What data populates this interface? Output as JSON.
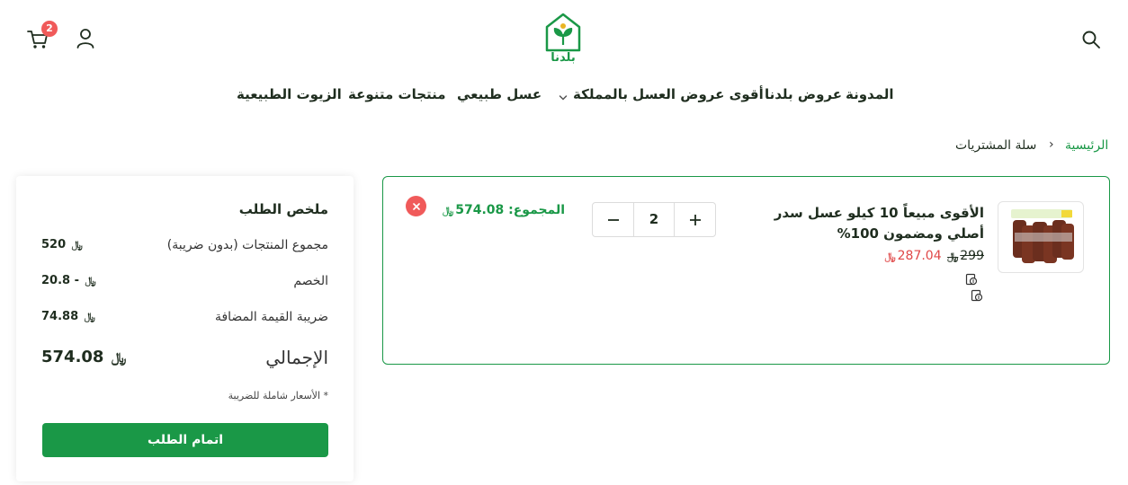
{
  "header": {
    "cart_count": "2",
    "logo_text": "بلدنا",
    "icons": [
      "cart-icon",
      "user-icon",
      "logo",
      "search-icon"
    ]
  },
  "nav": {
    "items": [
      {
        "label": "المدونة"
      },
      {
        "label": "عروض بلدنا"
      },
      {
        "label": "أقوى عروض العسل بالمملكة"
      },
      {
        "label": "عسل طبيعي"
      },
      {
        "label": "منتجات متنوعة"
      },
      {
        "label": "الزيوت الطبيعية"
      }
    ]
  },
  "breadcrumb": {
    "home": "الرئيسية",
    "separator": "›",
    "current": "سلة المشتريات"
  },
  "cart_item": {
    "name": "الأقوى مبيعاً 10 كيلو عسل سدر أصلي ومضمون 100%",
    "price_old": "299",
    "price_new": "287.04",
    "quantity": "2",
    "total_label": "المجموع:",
    "total_value": "574.08"
  },
  "summary": {
    "title": "ملخص الطلب",
    "subtotal_label": "مجموع المنتجات (بدون ضريبة)",
    "subtotal_value": "520",
    "discount_label": "الخصم",
    "discount_value": "- 20.8",
    "vat_label": "ضريبة القيمة المضافة",
    "vat_value": "74.88",
    "total_label": "الإجمالي",
    "total_value": "574.08",
    "tax_note": "* الأسعار شاملة للضريبة",
    "checkout_label": "اتمام الطلب"
  },
  "colors": {
    "brand_green": "#1a9847",
    "sale_red": "#e04848",
    "badge_red": "#f05a5a",
    "text_dark": "#1f2d1f"
  }
}
